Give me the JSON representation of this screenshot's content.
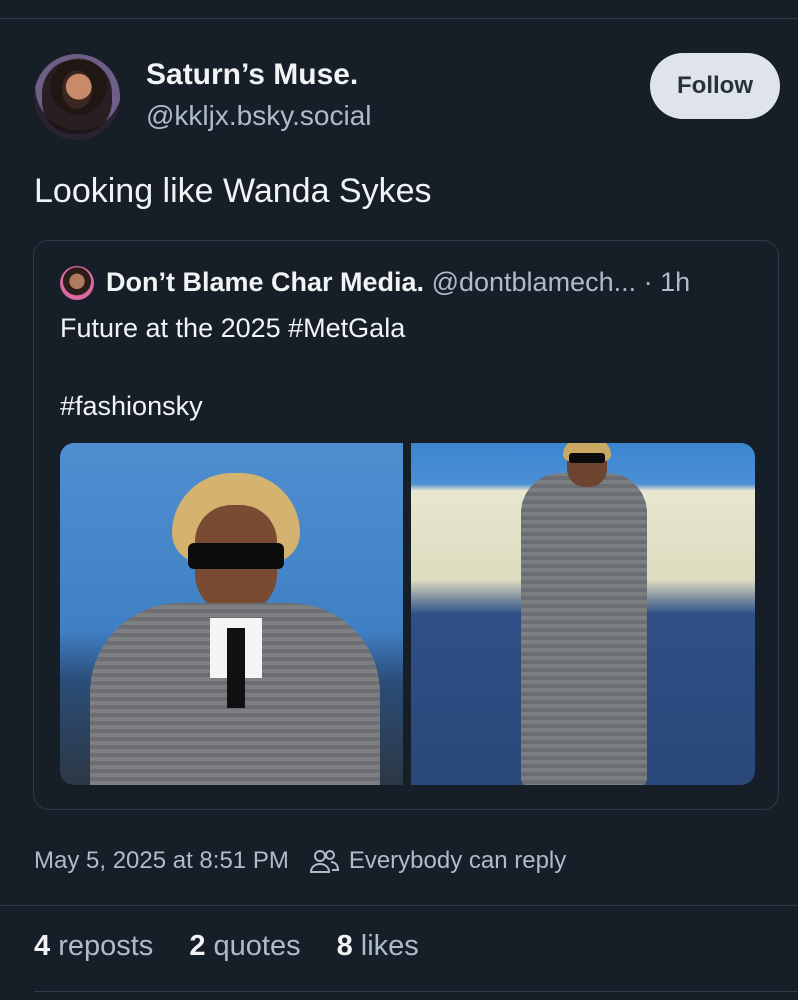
{
  "post": {
    "author_name": "Saturn’s Muse.",
    "author_handle": "@kkljx.bsky.social",
    "follow_label": "Follow",
    "text": "Looking like Wanda Sykes"
  },
  "quote": {
    "author_name": "Don’t Blame Char Media.",
    "author_handle": "@dontblamech...",
    "separator": "·",
    "time": "1h",
    "text_line1": "Future at the 2025 #MetGala",
    "text_line2": "#fashionsky"
  },
  "meta": {
    "timestamp": "May 5, 2025 at 8:51 PM",
    "reply_setting": "Everybody can reply",
    "reply_icon": "people-icon"
  },
  "stats": {
    "reposts_count": "4",
    "reposts_label": "reposts",
    "quotes_count": "2",
    "quotes_label": "quotes",
    "likes_count": "8",
    "likes_label": "likes"
  },
  "colors": {
    "background": "#161e27",
    "text_primary": "#f1f3f5",
    "text_secondary": "#aebbc9",
    "follow_button_bg": "#dfe4ea",
    "border": "#2e3a47"
  }
}
